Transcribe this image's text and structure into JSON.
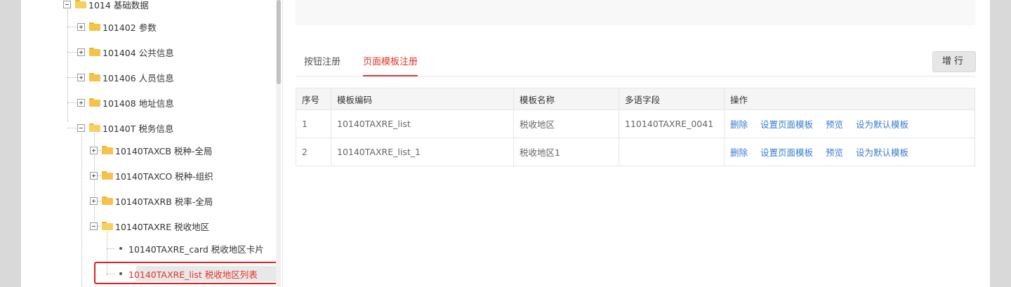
{
  "tree": {
    "root": {
      "label": "1014 基础数据"
    },
    "items": [
      {
        "label": "101402 参数"
      },
      {
        "label": "101404 公共信息"
      },
      {
        "label": "101406 人员信息"
      },
      {
        "label": "101408 地址信息"
      },
      {
        "label": "10140T 税务信息"
      }
    ],
    "tax_children": [
      {
        "label": "10140TAXCB 税种-全局"
      },
      {
        "label": "10140TAXCO 税种-组织"
      },
      {
        "label": "10140TAXRB 税率-全局"
      },
      {
        "label": "10140TAXRE 税收地区"
      }
    ],
    "leaves": [
      {
        "label": "10140TAXRE_card 税收地区卡片"
      },
      {
        "label": "10140TAXRE_list 税收地区列表",
        "selected": true
      }
    ]
  },
  "tabs": [
    {
      "label": "按钮注册"
    },
    {
      "label": "页面模板注册",
      "active": true
    }
  ],
  "toolbar": {
    "add_row_label": "增行"
  },
  "table": {
    "headers": [
      "序号",
      "模板编码",
      "模板名称",
      "多语字段",
      "操作"
    ],
    "rows": [
      {
        "index": "1",
        "code": "10140TAXRE_list",
        "name": "税收地区",
        "multilang": "110140TAXRE_0041"
      },
      {
        "index": "2",
        "code": "10140TAXRE_list_1",
        "name": "税收地区1",
        "multilang": ""
      }
    ],
    "actions": [
      "删除",
      "设置页面模板",
      "预览",
      "设为默认模板"
    ]
  },
  "colors": {
    "accent": "#e0352b",
    "link": "#3a7dd1",
    "highlight": "#e02020"
  }
}
